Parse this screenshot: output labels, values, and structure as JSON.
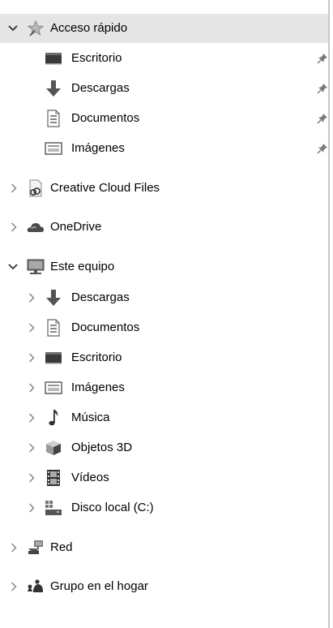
{
  "nav": {
    "quick_access": {
      "label": "Acceso rápido",
      "items": [
        {
          "label": "Escritorio",
          "icon": "desktop-icon",
          "pinned": true
        },
        {
          "label": "Descargas",
          "icon": "download-arrow-icon",
          "pinned": true
        },
        {
          "label": "Documentos",
          "icon": "document-icon",
          "pinned": true
        },
        {
          "label": "Imágenes",
          "icon": "pictures-icon",
          "pinned": true
        }
      ]
    },
    "creative_cloud": {
      "label": "Creative Cloud Files",
      "icon": "creative-cloud-icon"
    },
    "onedrive": {
      "label": "OneDrive",
      "icon": "cloud-icon"
    },
    "this_pc": {
      "label": "Este equipo",
      "icon": "computer-icon",
      "items": [
        {
          "label": "Descargas",
          "icon": "download-arrow-icon"
        },
        {
          "label": "Documentos",
          "icon": "document-icon"
        },
        {
          "label": "Escritorio",
          "icon": "desktop-icon"
        },
        {
          "label": "Imágenes",
          "icon": "pictures-icon"
        },
        {
          "label": "Música",
          "icon": "music-note-icon"
        },
        {
          "label": "Objetos 3D",
          "icon": "cube-3d-icon"
        },
        {
          "label": "Vídeos",
          "icon": "film-icon"
        },
        {
          "label": "Disco local (C:)",
          "icon": "drive-icon"
        }
      ]
    },
    "network": {
      "label": "Red",
      "icon": "network-icon"
    },
    "homegroup": {
      "label": "Grupo en el hogar",
      "icon": "homegroup-icon"
    }
  }
}
